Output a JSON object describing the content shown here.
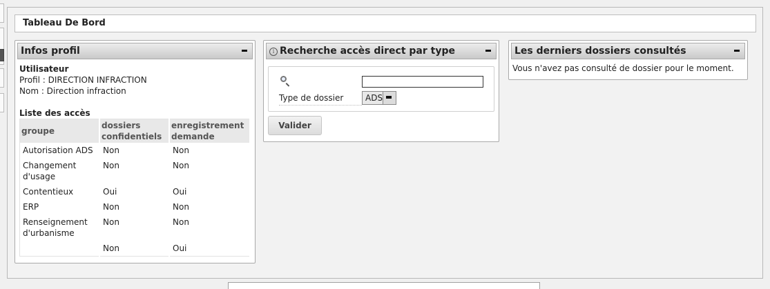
{
  "page": {
    "title": "Tableau De Bord"
  },
  "profil_widget": {
    "title": "Infos profil",
    "user_heading": "Utilisateur",
    "profil_line": "Profil : DIRECTION INFRACTION",
    "nom_line": "Nom : Direction infraction",
    "access_heading": "Liste des accès",
    "columns": {
      "groupe": "groupe",
      "confidentiels_1": "dossiers",
      "confidentiels_2": "confidentiels",
      "enregistrement_1": "enregistrement",
      "enregistrement_2": "demande"
    },
    "rows": [
      {
        "groupe_1": "Autorisation ADS",
        "groupe_2": "",
        "confidentiels": "Non",
        "enregistrement": "Non"
      },
      {
        "groupe_1": "Changement",
        "groupe_2": "d'usage",
        "confidentiels": "Non",
        "enregistrement": "Non"
      },
      {
        "groupe_1": "Contentieux",
        "groupe_2": "",
        "confidentiels": "Oui",
        "enregistrement": "Oui"
      },
      {
        "groupe_1": "ERP",
        "groupe_2": "",
        "confidentiels": "Non",
        "enregistrement": "Non"
      },
      {
        "groupe_1": "Renseignement",
        "groupe_2": "d'urbanisme",
        "confidentiels": "Non",
        "enregistrement": "Non"
      },
      {
        "groupe_1": "",
        "groupe_2": "",
        "confidentiels": "Non",
        "enregistrement": "Oui"
      }
    ]
  },
  "recherche_widget": {
    "title": "Recherche accès direct par type",
    "search_value": "",
    "type_label": "Type de dossier",
    "type_selected": "ADS",
    "submit_label": "Valider"
  },
  "derniers_widget": {
    "title": "Les derniers dossiers consultés",
    "message": "Vous n'avez pas consulté de dossier pour le moment."
  },
  "icons": {
    "collapse": "minus-icon",
    "info": "info-icon",
    "search": "magnifier-icon"
  }
}
